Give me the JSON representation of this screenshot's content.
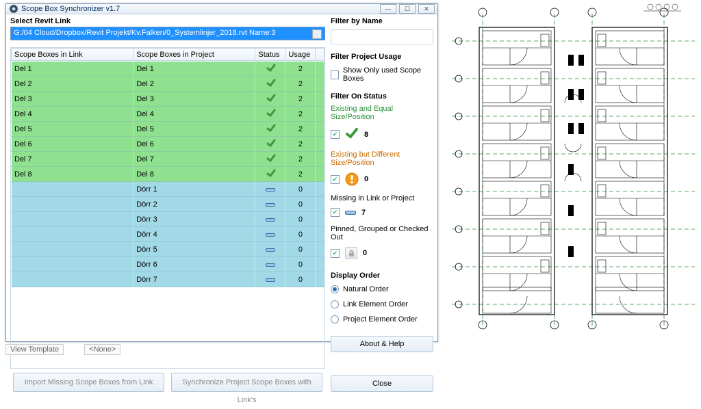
{
  "window": {
    "title": "Scope Box Synchronizer v1.7"
  },
  "left": {
    "select_label": "Select Revit Link",
    "dropdown_value": "G:/04 Cloud/Dropbox/Revit Projekt/Kv.Falken/0_Systemlinjer_2018.rvt Name:3",
    "columns": {
      "link": "Scope Boxes in Link",
      "project": "Scope Boxes in Project",
      "status": "Status",
      "usage": "Usage"
    },
    "rows_green": [
      {
        "link": "Del 1",
        "project": "Del 1",
        "usage": "2"
      },
      {
        "link": "Del 2",
        "project": "Del 2",
        "usage": "2"
      },
      {
        "link": "Del 3",
        "project": "Del 3",
        "usage": "2"
      },
      {
        "link": "Del 4",
        "project": "Del 4",
        "usage": "2"
      },
      {
        "link": "Del 5",
        "project": "Del 5",
        "usage": "2"
      },
      {
        "link": "Del 6",
        "project": "Del 6",
        "usage": "2"
      },
      {
        "link": "Del 7",
        "project": "Del 7",
        "usage": "2"
      },
      {
        "link": "Del 8",
        "project": "Del 8",
        "usage": "2"
      }
    ],
    "rows_blue": [
      {
        "link": "",
        "project": "Dörr 1",
        "usage": "0"
      },
      {
        "link": "",
        "project": "Dörr 2",
        "usage": "0"
      },
      {
        "link": "",
        "project": "Dörr 3",
        "usage": "0"
      },
      {
        "link": "",
        "project": "Dörr 4",
        "usage": "0"
      },
      {
        "link": "",
        "project": "Dörr 5",
        "usage": "0"
      },
      {
        "link": "",
        "project": "Dörr 6",
        "usage": "0"
      },
      {
        "link": "",
        "project": "Dörr 7",
        "usage": "0"
      }
    ],
    "btn_import": "Import Missing Scope Boxes from Link",
    "btn_sync": "Synchronize Project Scope Boxes with Link's"
  },
  "right": {
    "filter_name_label": "Filter by Name",
    "filter_name_value": "",
    "filter_usage_label": "Filter Project Usage",
    "show_only_used": "Show Only used Scope Boxes",
    "filter_status_label": "Filter On Status",
    "status_equal_label": "Existing and Equal Size/Position",
    "status_equal_count": "8",
    "status_diff_label": "Existing but Different Size/Position",
    "status_diff_count": "0",
    "status_missing_label": "Missing in Link or Project",
    "status_missing_count": "7",
    "status_pinned_label": "Pinned, Grouped or Checked Out",
    "status_pinned_count": "0",
    "display_order_label": "Display Order",
    "order_natural": "Natural Order",
    "order_link": "Link Element Order",
    "order_project": "Project Element Order",
    "btn_about": "About & Help",
    "btn_close": "Close"
  },
  "bottom": {
    "left_hint": "View Template",
    "right_hint": "<None>"
  }
}
